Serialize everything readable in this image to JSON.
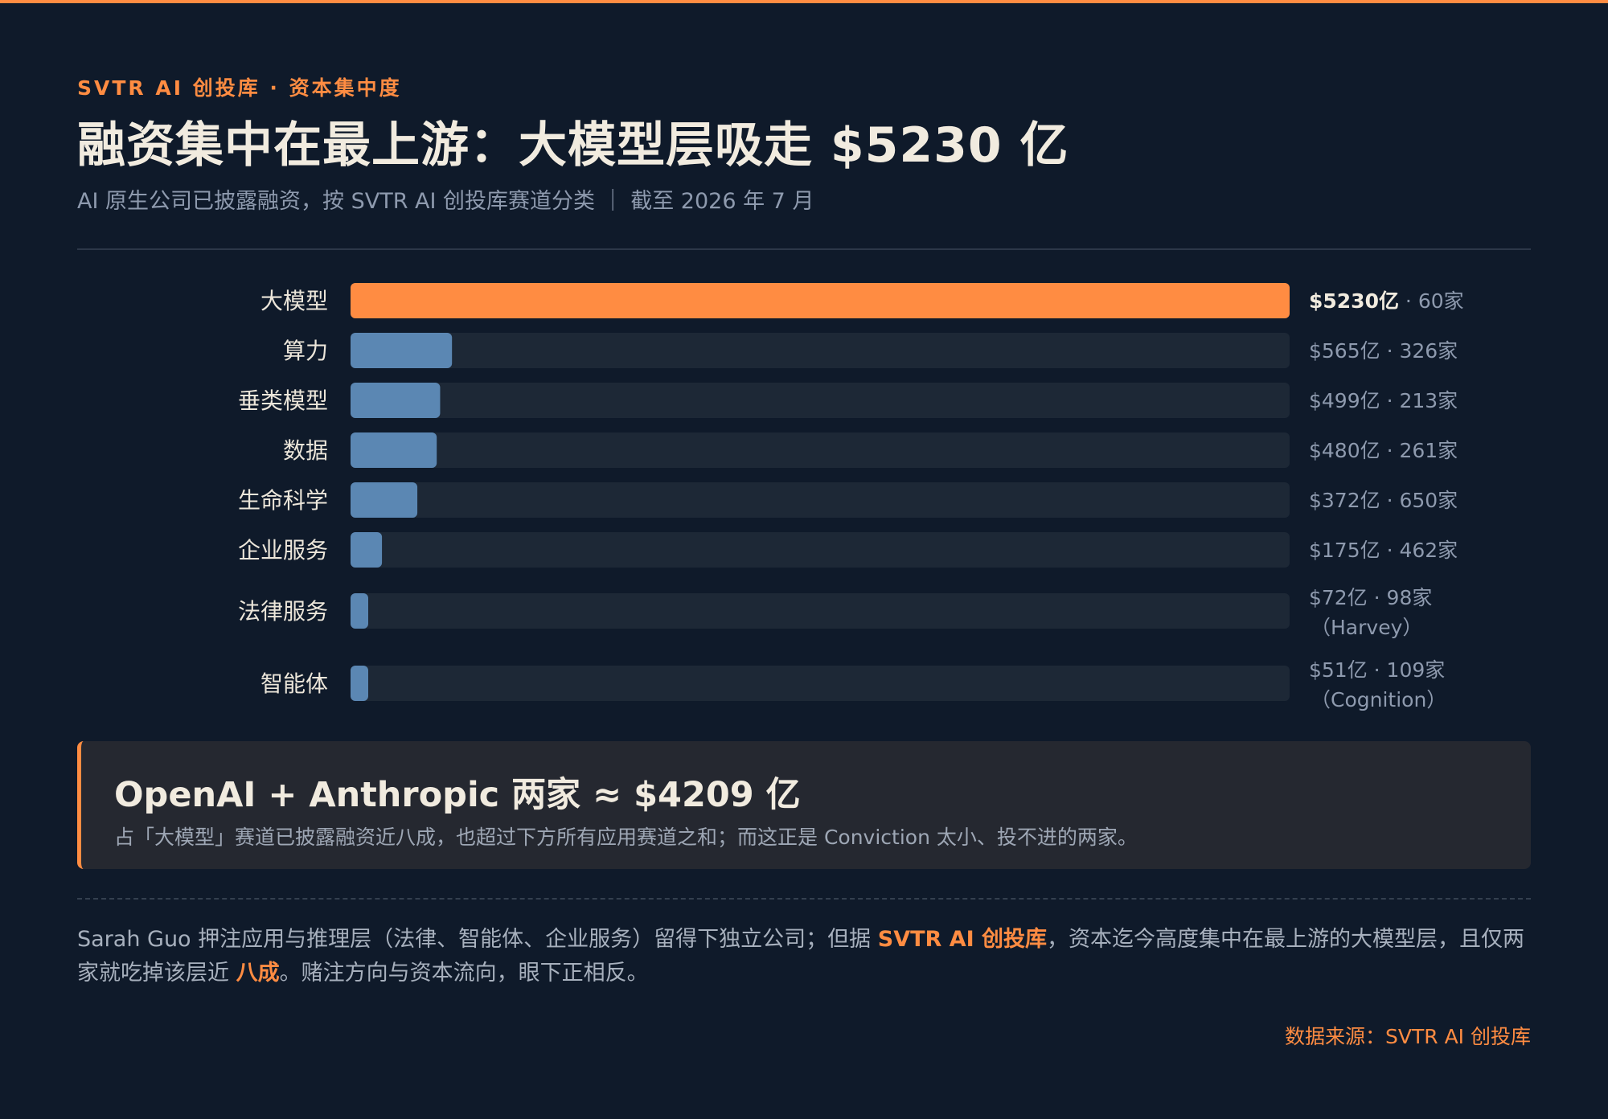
{
  "header": {
    "kicker": "SVTR AI 创投库 · 资本集中度",
    "title": "融资集中在最上游：大模型层吸走 $5230 亿",
    "subtitle": "AI 原生公司已披露融资，按 SVTR AI 创投库赛道分类 ｜ 截至 2026 年 7 月"
  },
  "colors": {
    "accent": "#ff8c42",
    "bar": "#5b87b3",
    "track": "#1d2836",
    "background": "#0f1a2a"
  },
  "chart_data": {
    "type": "bar",
    "orientation": "horizontal",
    "unit": "亿美元",
    "xlim": [
      0,
      5230
    ],
    "categories": [
      "大模型",
      "算力",
      "垂类模型",
      "数据",
      "生命科学",
      "企业服务",
      "法律服务",
      "智能体"
    ],
    "values": [
      5230,
      565,
      499,
      480,
      372,
      175,
      72,
      51
    ],
    "highlight": [
      true,
      false,
      false,
      false,
      false,
      false,
      false,
      false
    ],
    "value_labels": [
      "$5230亿",
      "$565亿",
      "$499亿",
      "$480亿",
      "$372亿",
      "$175亿",
      "$72亿",
      "$51亿"
    ],
    "count_labels": [
      "60家",
      "326家",
      "213家",
      "261家",
      "650家",
      "462家",
      "98家",
      "109家"
    ],
    "notes": [
      "",
      "",
      "",
      "",
      "",
      "",
      "（Harvey）",
      "（Cognition）"
    ]
  },
  "callout": {
    "title": "OpenAI + Anthropic 两家 ≈ $4209 亿",
    "text": "占「大模型」赛道已披露融资近八成，也超过下方所有应用赛道之和；而这正是 Conviction 太小、投不进的两家。"
  },
  "note": {
    "part1": "Sarah Guo 押注应用与推理层（法律、智能体、企业服务）留得下独立公司；但据 ",
    "em1": "SVTR AI 创投库",
    "part2": "，资本迄今高度集中在最上游的大模型层，且仅两家就吃掉该层近 ",
    "em2": "八成",
    "part3": "。赌注方向与资本流向，眼下正相反。"
  },
  "source": "数据来源：SVTR AI 创投库"
}
